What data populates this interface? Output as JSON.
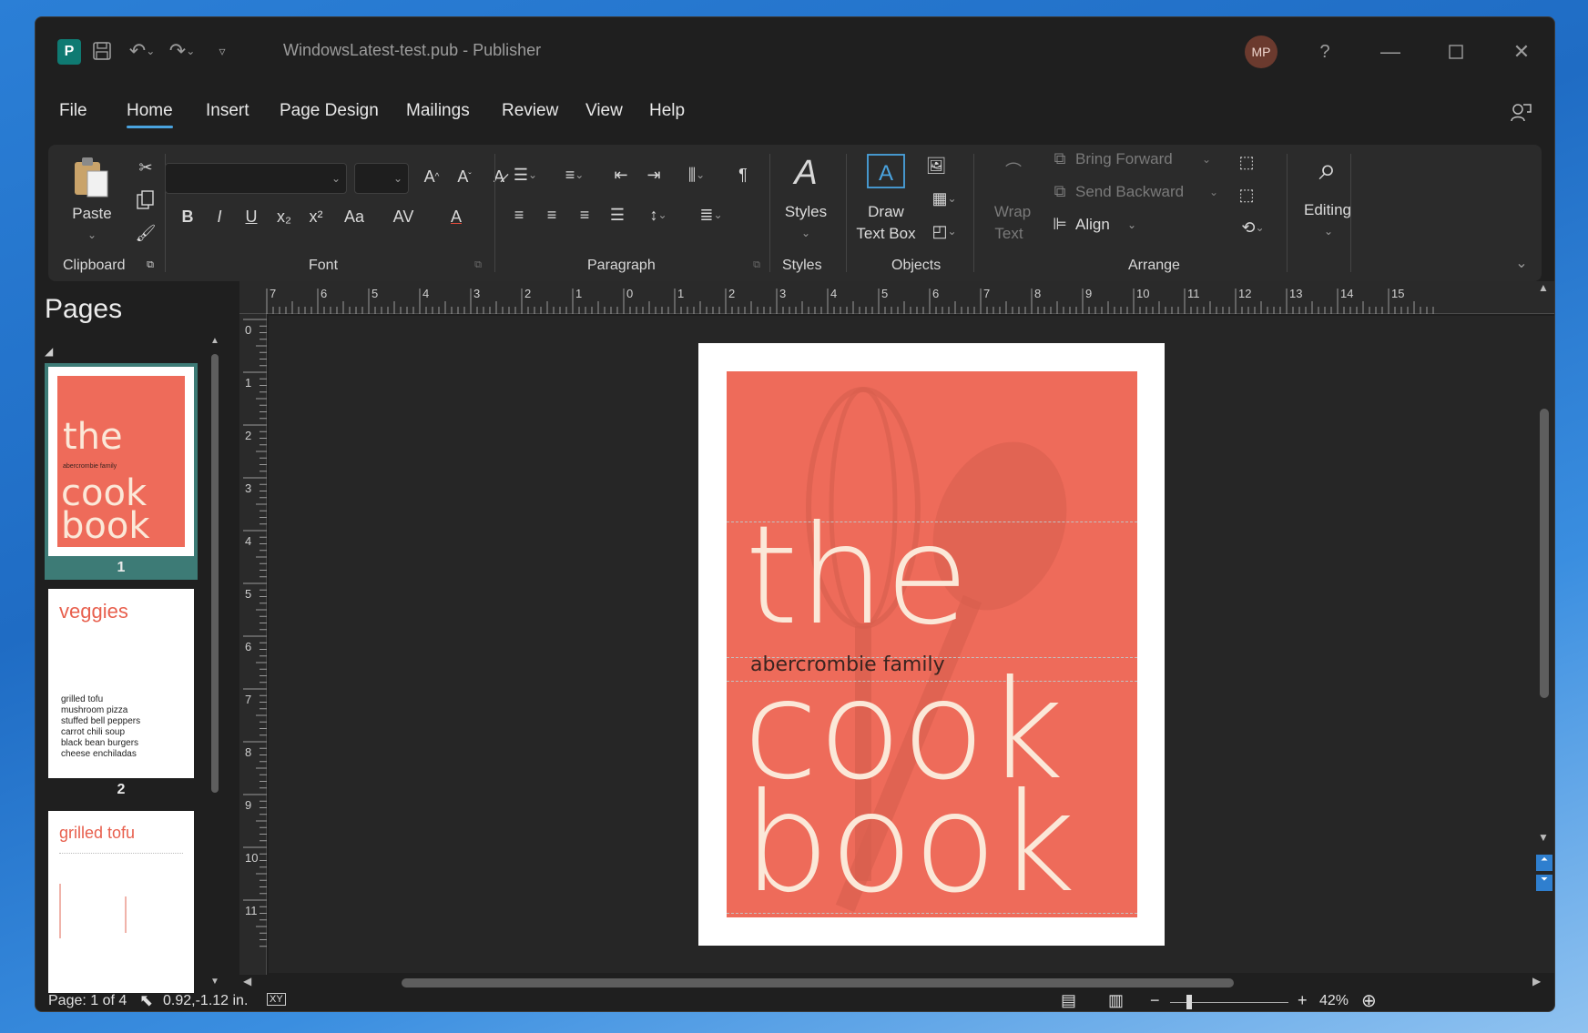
{
  "window": {
    "doc_title": "WindowsLatest-test.pub  -  Publisher",
    "avatar_initials": "MP",
    "help_glyph": "?",
    "app_logo": "P"
  },
  "menu": {
    "tabs": [
      "File",
      "Home",
      "Insert",
      "Page Design",
      "Mailings",
      "Review",
      "View",
      "Help"
    ],
    "active_tab": "Home"
  },
  "ribbon": {
    "groups": {
      "clipboard": "Clipboard",
      "font": "Font",
      "paragraph": "Paragraph",
      "styles": "Styles",
      "objects": "Objects",
      "arrange": "Arrange"
    },
    "paste_label": "Paste",
    "styles_label": "Styles",
    "draw_textbox_label_1": "Draw",
    "draw_textbox_label_2": "Text Box",
    "wrap_text_label_1": "Wrap",
    "wrap_text_label_2": "Text",
    "bring_forward": "Bring Forward",
    "send_backward": "Send Backward",
    "align": "Align",
    "editing": "Editing",
    "font_buttons": {
      "bold": "B",
      "italic": "I",
      "underline": "U",
      "subscript": "x₂",
      "superscript": "x²",
      "case": "Aa",
      "spacing": "AV",
      "font_color": "A",
      "grow": "A^",
      "shrink": "Aˇ"
    },
    "pilcrow": "¶"
  },
  "pages_pane": {
    "title": "Pages",
    "pages": [
      {
        "number": "1",
        "kind": "cover"
      },
      {
        "number": "2",
        "kind": "list",
        "heading": "veggies",
        "items": [
          "grilled tofu",
          "mushroom pizza",
          "stuffed bell peppers",
          "carrot chili soup",
          "black bean burgers",
          "cheese enchiladas"
        ]
      },
      {
        "number": "",
        "kind": "recipe",
        "heading": "grilled tofu"
      }
    ]
  },
  "cover": {
    "line1": "the",
    "subtitle": "abercrombie family",
    "line2": "cook",
    "line3": "book",
    "thumb_subtitle": "abercrombie family",
    "bg_color": "#ee6b5a",
    "text_color": "#fbe8d8"
  },
  "rulers": {
    "horizontal": [
      "7",
      "6",
      "5",
      "4",
      "3",
      "2",
      "1",
      "0",
      "1",
      "2",
      "3",
      "4",
      "5",
      "6",
      "7",
      "8",
      "9",
      "10",
      "11",
      "12",
      "13",
      "14",
      "15"
    ],
    "vertical": [
      "0",
      "1",
      "2",
      "3",
      "4",
      "5",
      "6",
      "7",
      "8",
      "9",
      "10",
      "11"
    ]
  },
  "status": {
    "page": "Page: 1 of 4",
    "position": "0.92,-1.12 in.",
    "zoom": "42%"
  }
}
